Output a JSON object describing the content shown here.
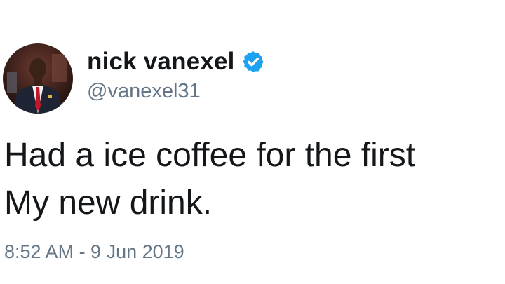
{
  "tweet": {
    "user": {
      "display_name": "nick vanexel",
      "handle": "@vanexel31",
      "verified": true,
      "verified_icon": "verified-badge-icon",
      "avatar": "profile-photo"
    },
    "text_lines": [
      "Had a ice coffee for the first",
      "My new drink."
    ],
    "timestamp": "8:52 AM - 9 Jun 2019"
  },
  "colors": {
    "text": "#14171a",
    "secondary": "#657786",
    "verified": "#1da1f2",
    "background": "#ffffff"
  }
}
